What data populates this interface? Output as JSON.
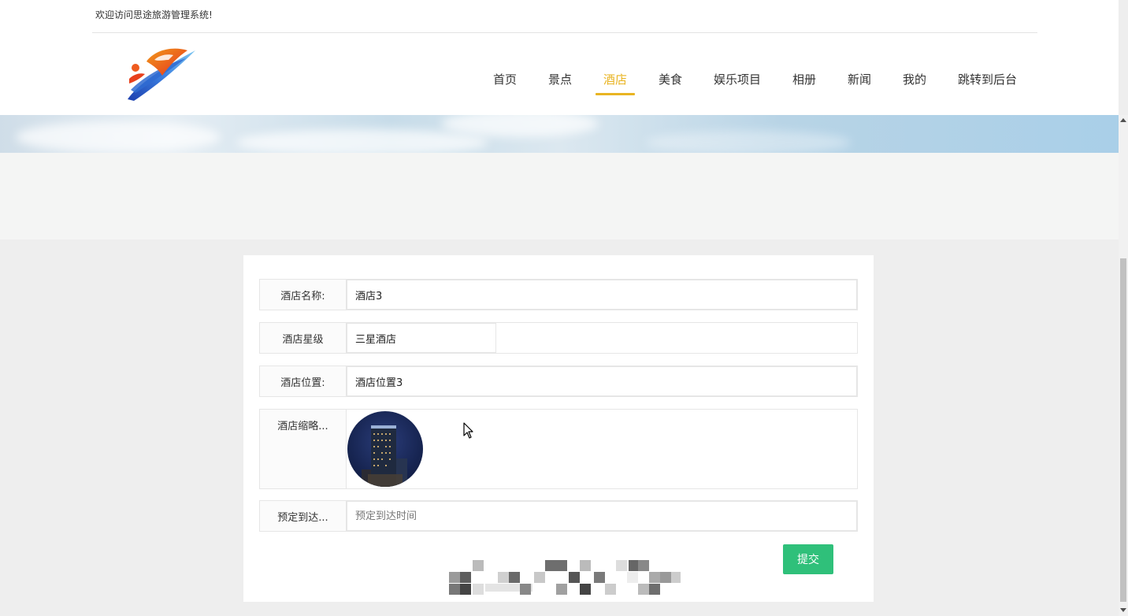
{
  "header": {
    "welcome_text": "欢迎访问思途旅游管理系统!",
    "logo_icon": "brand-logo-icon",
    "accent_color": "#e9b422"
  },
  "nav": {
    "items": [
      {
        "label": "首页",
        "active": false
      },
      {
        "label": "景点",
        "active": false
      },
      {
        "label": "酒店",
        "active": true
      },
      {
        "label": "美食",
        "active": false
      },
      {
        "label": "娱乐项目",
        "active": false
      },
      {
        "label": "相册",
        "active": false
      },
      {
        "label": "新闻",
        "active": false
      },
      {
        "label": "我的",
        "active": false
      },
      {
        "label": "跳转到后台",
        "active": false
      }
    ]
  },
  "form": {
    "hotel_name": {
      "label": "酒店名称:",
      "value": "酒店3"
    },
    "hotel_star": {
      "label": "酒店星级",
      "value": "三星酒店"
    },
    "hotel_location": {
      "label": "酒店位置:",
      "value": "酒店位置3"
    },
    "hotel_thumbnail": {
      "label": "酒店缩略..."
    },
    "arrival_time": {
      "label": "预定到达...",
      "placeholder": "预定到达时间",
      "value": ""
    },
    "submit_label": "提交",
    "submit_color": "#2fc07a"
  }
}
